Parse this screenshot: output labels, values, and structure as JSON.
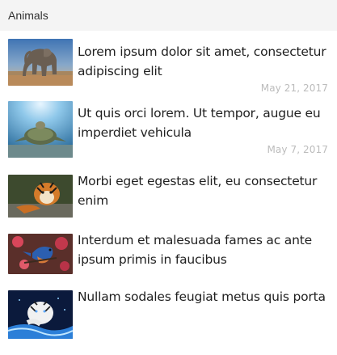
{
  "header": {
    "title": "Animals"
  },
  "items": [
    {
      "title": "Lorem ipsum dolor sit amet, consectetur adipiscing elit",
      "date": "May 21, 2017",
      "image": "elephant-photo"
    },
    {
      "title": "Ut quis orci lorem. Ut tempor, augue eu imperdiet vehicula",
      "date": "May 7, 2017",
      "image": "turtle-photo"
    },
    {
      "title": "Morbi eget egestas elit, eu consectetur enim",
      "date": "",
      "image": "tiger-photo"
    },
    {
      "title": "Interdum et malesuada fames ac ante ipsum primis in faucibus",
      "date": "",
      "image": "bird-photo"
    },
    {
      "title": "Nullam sodales feugiat metus quis porta",
      "date": "",
      "image": "white-tiger-photo"
    }
  ]
}
